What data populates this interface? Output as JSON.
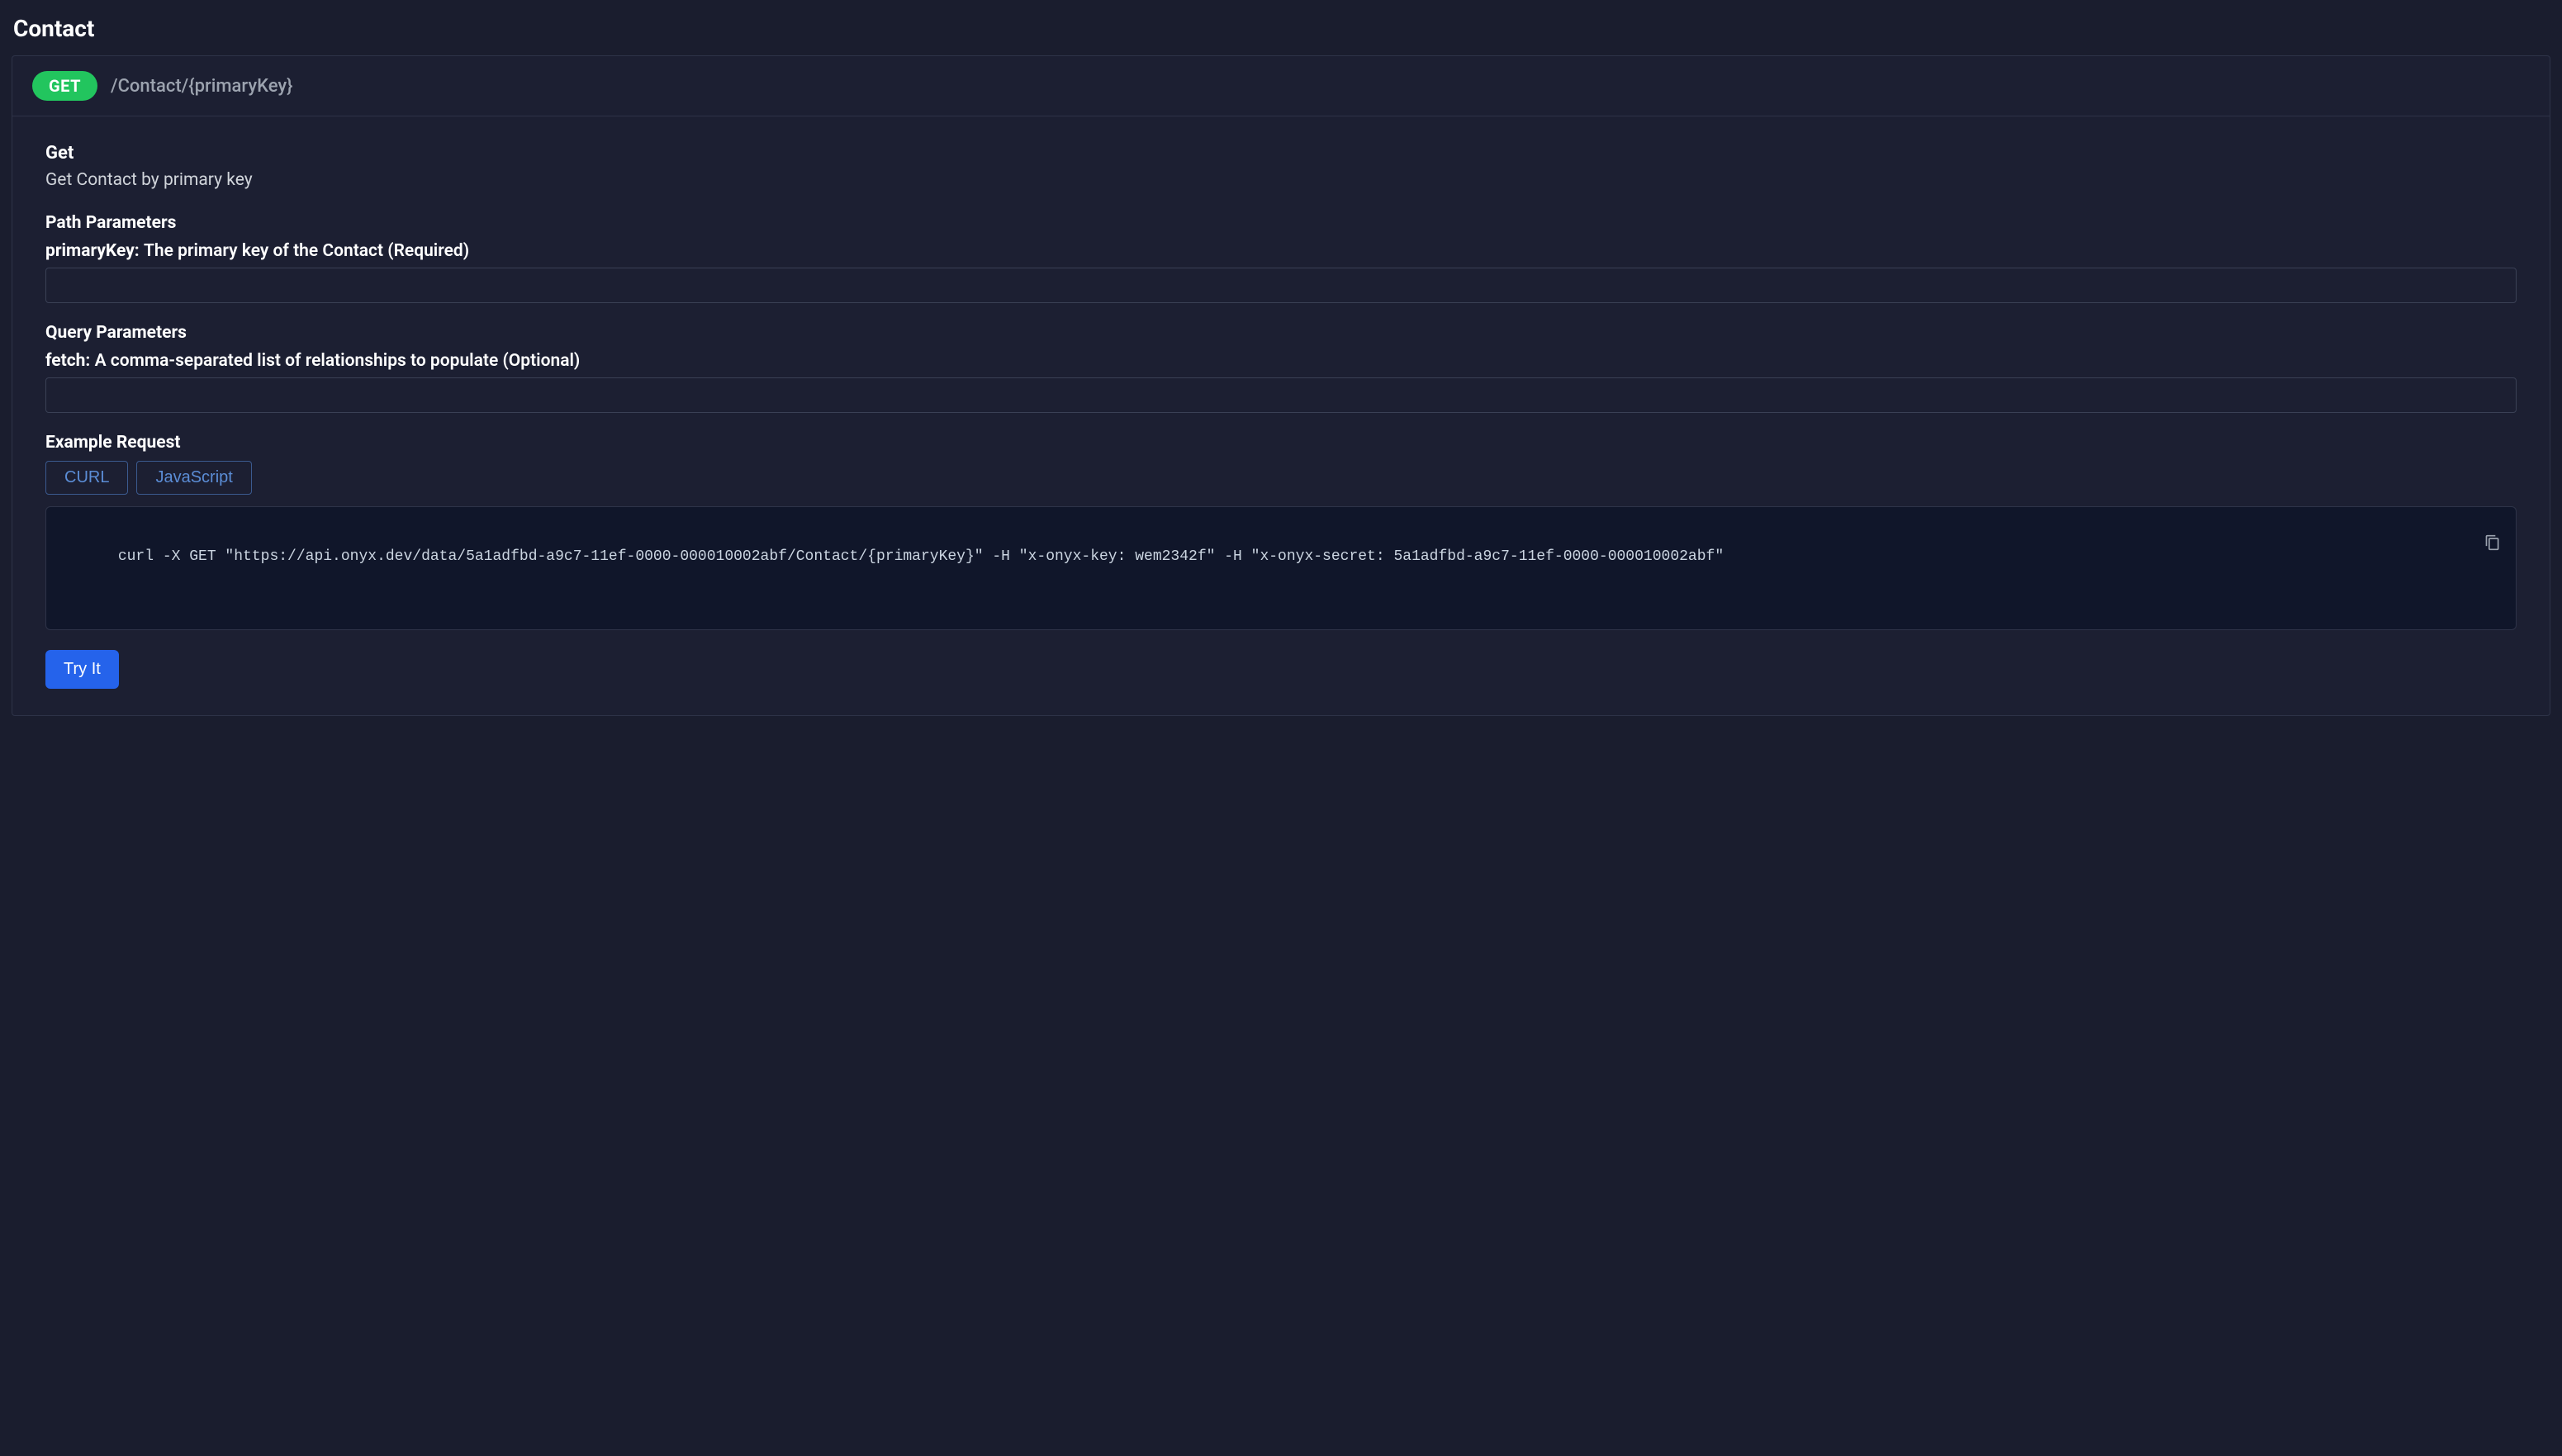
{
  "page": {
    "title": "Contact"
  },
  "endpoint": {
    "method": "GET",
    "path": "/Contact/{primaryKey}",
    "summary_title": "Get",
    "summary_desc": "Get Contact by primary key"
  },
  "path_params": {
    "heading": "Path Parameters",
    "param_name": "primaryKey: ",
    "param_desc": "The primary key of the Contact (Required)",
    "value": ""
  },
  "query_params": {
    "heading": "Query Parameters",
    "param_name": "fetch: ",
    "param_desc": "A comma-separated list of relationships to populate (Optional)",
    "value": ""
  },
  "example": {
    "heading": "Example Request",
    "tabs": {
      "curl": "CURL",
      "js": "JavaScript"
    },
    "code": "curl -X GET \"https://api.onyx.dev/data/5a1adfbd-a9c7-11ef-0000-000010002abf/Contact/{primaryKey}\" -H \"x-onyx-key: wem2342f\" -H \"x-onyx-secret: 5a1adfbd-a9c7-11ef-0000-000010002abf\""
  },
  "actions": {
    "try_it": "Try It"
  }
}
